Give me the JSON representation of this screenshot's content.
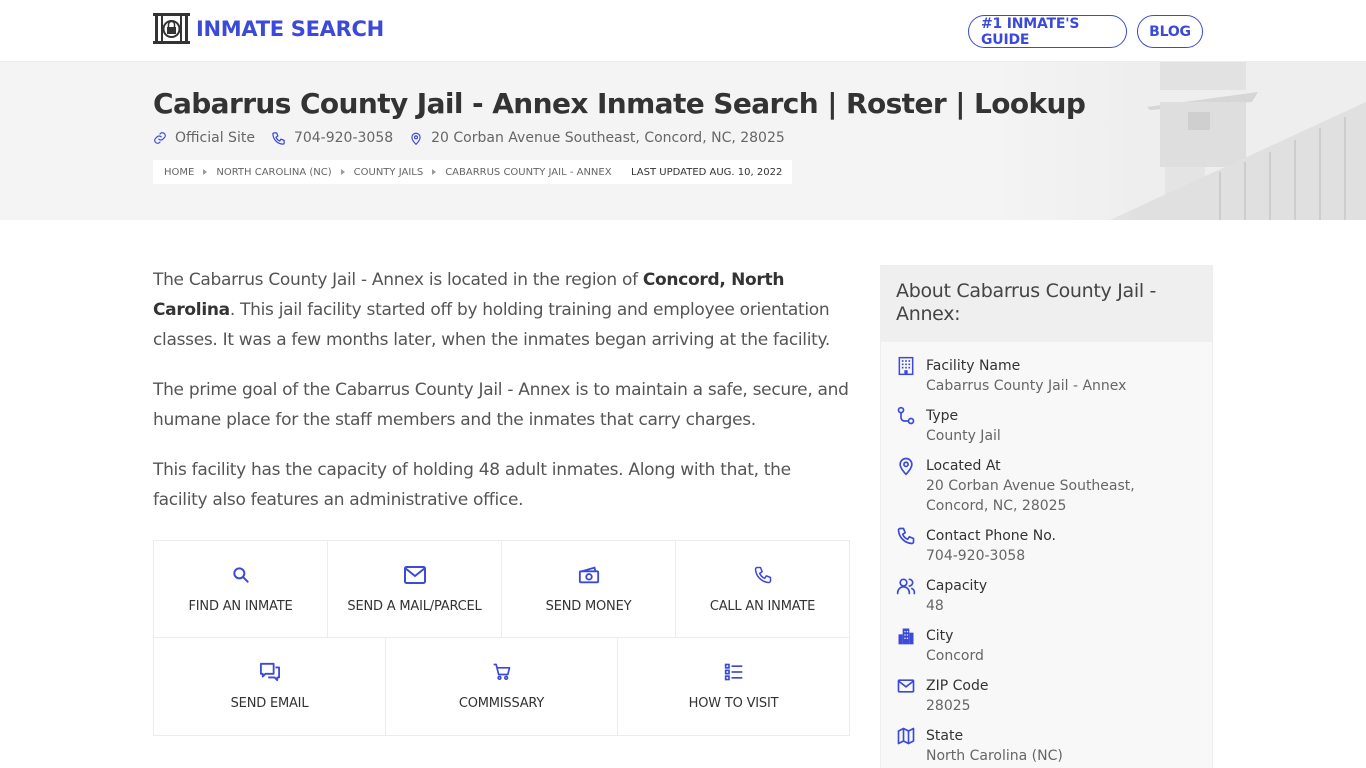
{
  "header": {
    "logo_text": "INMATE SEARCH",
    "nav": [
      {
        "label": "#1 INMATE'S GUIDE"
      },
      {
        "label": "BLOG"
      }
    ],
    "accent_color": "#3b4ad8"
  },
  "hero": {
    "title": "Cabarrus County Jail - Annex Inmate Search | Roster | Lookup",
    "official_site": "Official Site",
    "phone": "704-920-3058",
    "address": "20 Corban Avenue Southeast, Concord, NC, 28025",
    "breadcrumbs": [
      {
        "label": "HOME"
      },
      {
        "label": "NORTH CAROLINA (NC)"
      },
      {
        "label": "COUNTY JAILS"
      },
      {
        "label": "CABARRUS COUNTY JAIL - ANNEX"
      }
    ],
    "last_updated": "LAST UPDATED AUG. 10, 2022"
  },
  "content": {
    "p1_before": "The Cabarrus County Jail - Annex is located in the region of ",
    "p1_bold": "Concord, North Carolina",
    "p1_after": ". This jail facility started off by holding training and employee orientation classes. It was a few months later, when the inmates began arriving at the facility.",
    "p2": "The prime goal of the Cabarrus County Jail - Annex is to maintain a safe, secure, and humane place for the staff members and the inmates that carry charges.",
    "p3": "This facility has the capacity of holding 48 adult inmates. Along with that, the facility also features an administrative office."
  },
  "actions": [
    {
      "label": "FIND AN INMATE",
      "icon": "search-icon"
    },
    {
      "label": "SEND A MAIL/PARCEL",
      "icon": "mail-icon"
    },
    {
      "label": "SEND MONEY",
      "icon": "money-icon"
    },
    {
      "label": "CALL AN INMATE",
      "icon": "phone-icon"
    },
    {
      "label": "SEND EMAIL",
      "icon": "chat-icon"
    },
    {
      "label": "COMMISSARY",
      "icon": "cart-icon"
    },
    {
      "label": "HOW TO VISIT",
      "icon": "list-icon"
    }
  ],
  "about": {
    "title": "About Cabarrus County Jail - Annex:",
    "items": [
      {
        "label": "Facility Name",
        "value": "Cabarrus County Jail - Annex",
        "icon": "building-icon"
      },
      {
        "label": "Type",
        "value": "County Jail",
        "icon": "route-icon"
      },
      {
        "label": "Located At",
        "value": "20 Corban Avenue Southeast, Concord, NC, 28025",
        "icon": "location-pin-icon"
      },
      {
        "label": "Contact Phone No.",
        "value": "704-920-3058",
        "icon": "phone-icon"
      },
      {
        "label": "Capacity",
        "value": "48",
        "icon": "users-icon"
      },
      {
        "label": "City",
        "value": "Concord",
        "icon": "city-icon"
      },
      {
        "label": "ZIP Code",
        "value": "28025",
        "icon": "envelope-icon"
      },
      {
        "label": "State",
        "value": "North Carolina (NC)",
        "icon": "map-icon"
      }
    ]
  }
}
